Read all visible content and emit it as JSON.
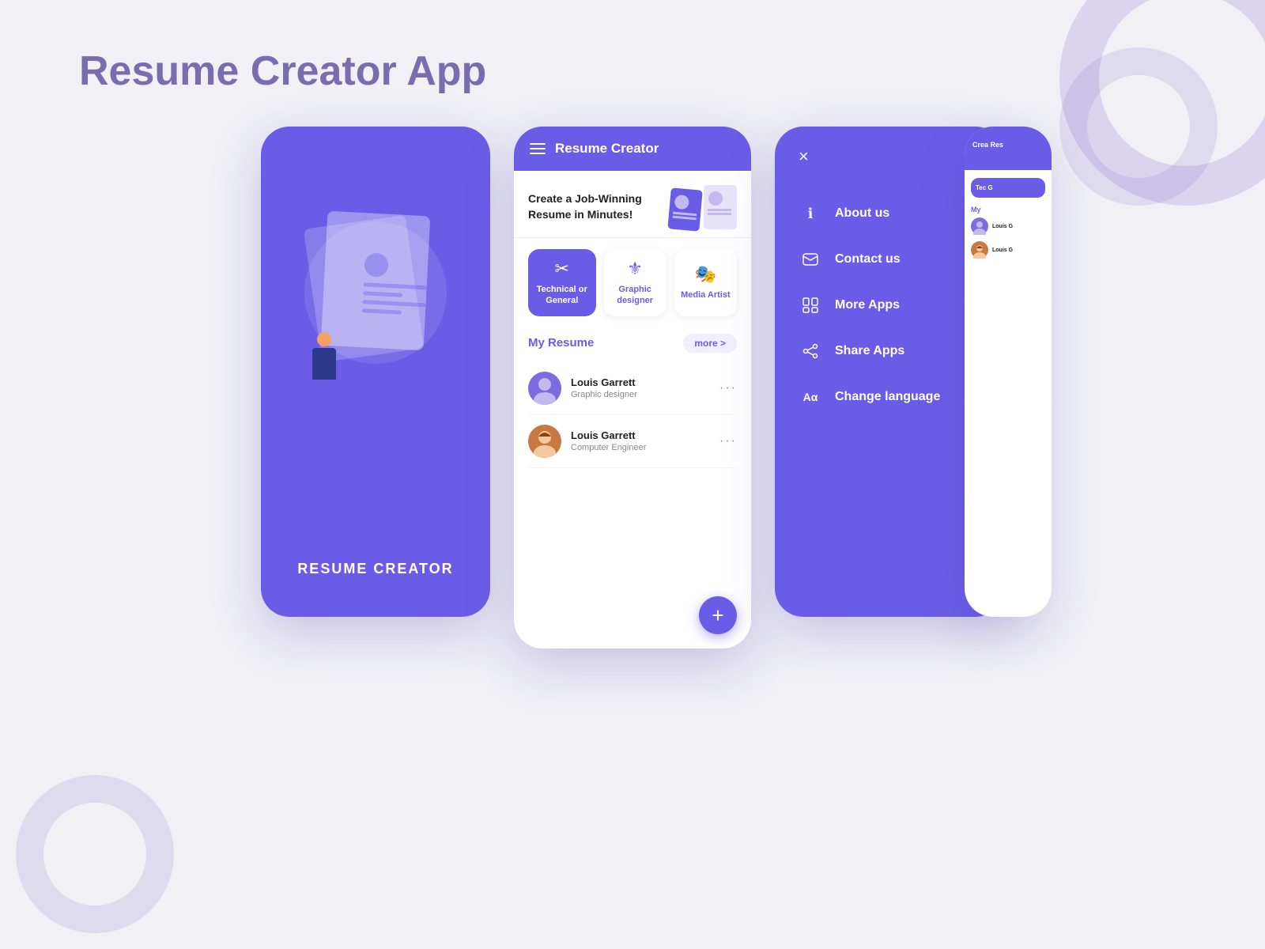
{
  "page": {
    "title": "Resume Creator App",
    "bg_color": "#f0f0f5",
    "accent_color": "#6b5ce7"
  },
  "phone1": {
    "label": "RESUME CREATOR",
    "bg_color": "#6b5ce7"
  },
  "phone2": {
    "header": {
      "title": "Resume Creator"
    },
    "banner": {
      "text": "Create a Job-Winning\nResume in Minutes!"
    },
    "categories": [
      {
        "label": "Technical or\nGeneral",
        "icon": "✂",
        "active": true
      },
      {
        "label": "Graphic\ndesigner",
        "icon": "⚜",
        "active": false
      },
      {
        "label": "Media\nArtist",
        "icon": "🎭",
        "active": false
      }
    ],
    "resume_section": {
      "title": "My Resume",
      "more_label": "more >",
      "items": [
        {
          "name": "Louis Garrett",
          "role": "Graphic designer"
        },
        {
          "name": "Louis Garrett",
          "role": "Computer Engineer"
        }
      ]
    },
    "fab_label": "+"
  },
  "phone3": {
    "close_icon": "×",
    "menu_items": [
      {
        "label": "About us",
        "icon": "ℹ"
      },
      {
        "label": "Contact us",
        "icon": "📞"
      },
      {
        "label": "More Apps",
        "icon": "📱"
      },
      {
        "label": "Share Apps",
        "icon": "↗"
      },
      {
        "label": "Change language",
        "icon": "Aa"
      }
    ]
  },
  "peek": {
    "header_text": "Crea\nRes",
    "btn_text": "Tec\nG",
    "section_title": "My"
  }
}
